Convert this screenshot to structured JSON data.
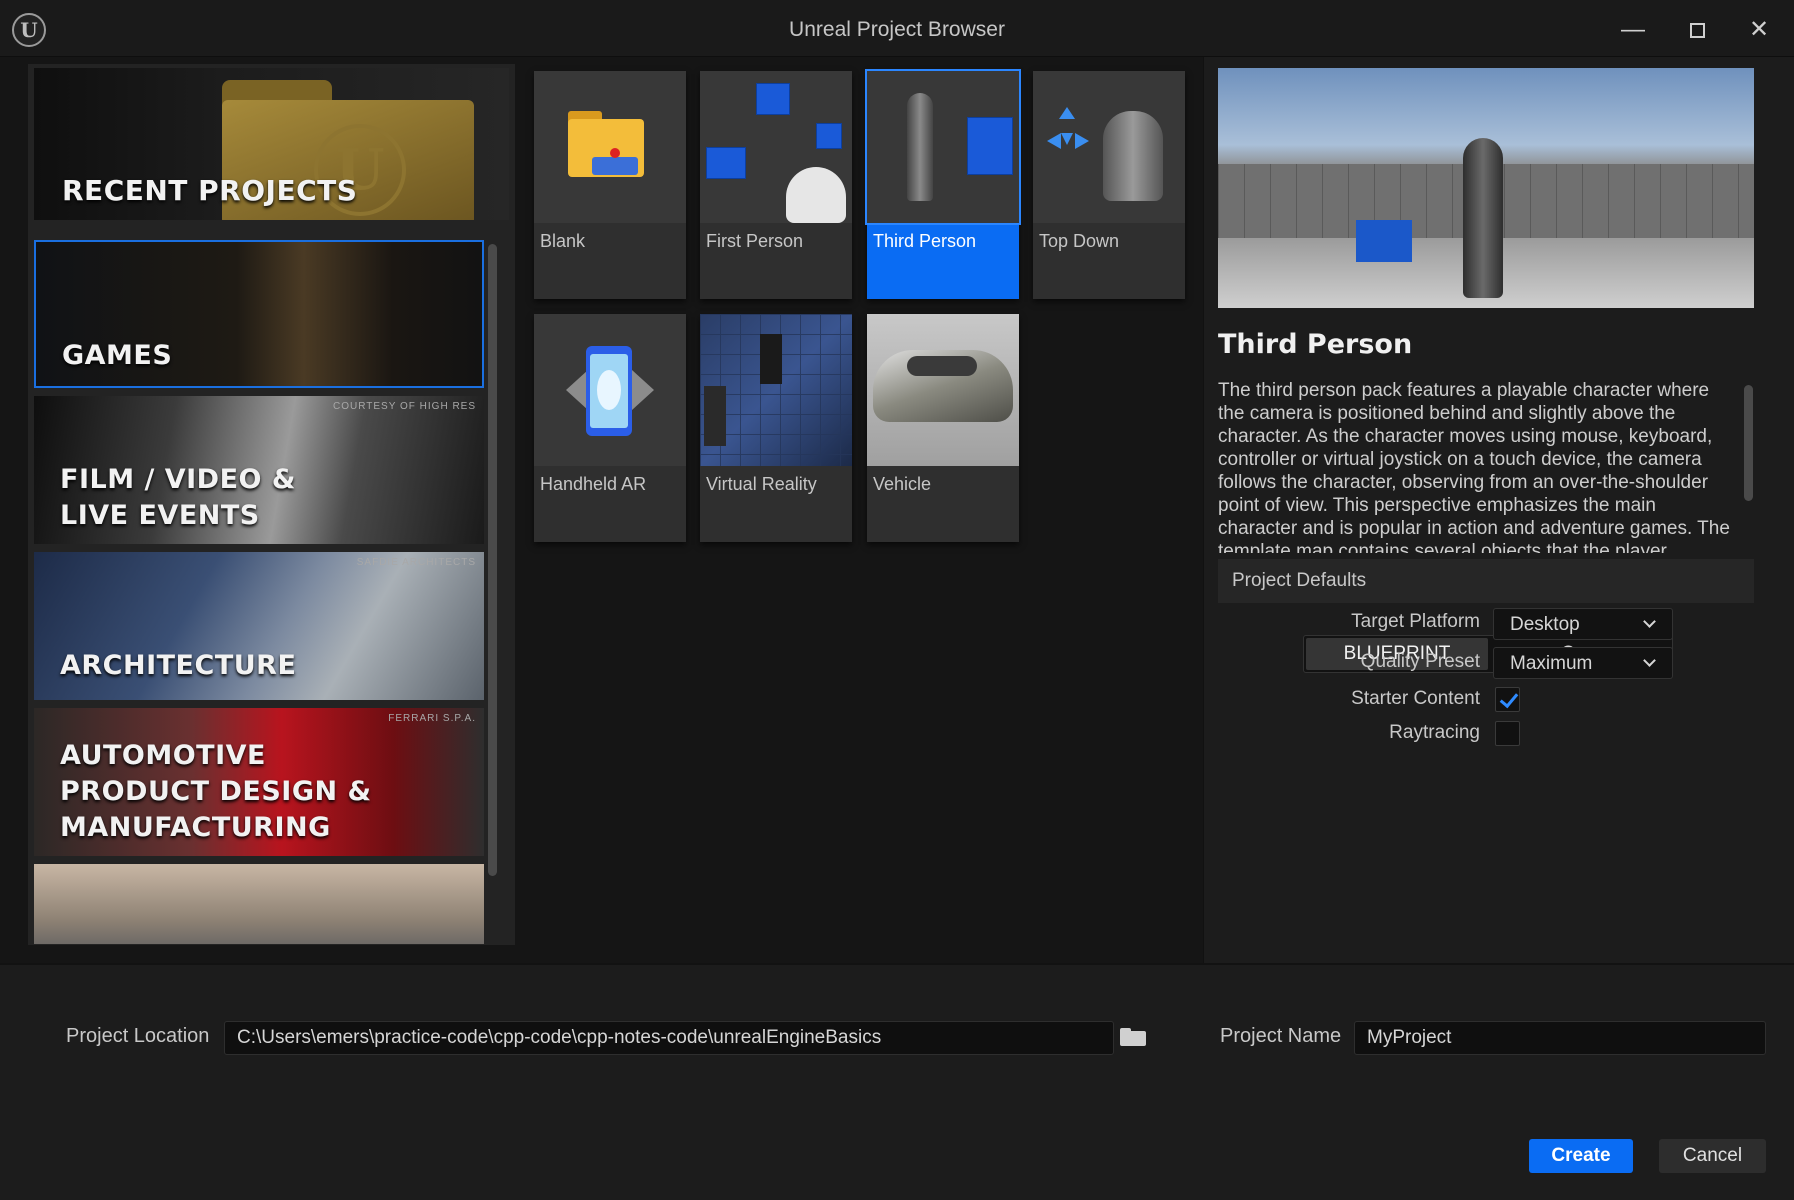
{
  "window": {
    "title": "Unreal Project Browser",
    "logo_letter": "U",
    "minimize_glyph": "—",
    "close_glyph": "✕"
  },
  "categories": {
    "recent": "RECENT PROJECTS",
    "games": "GAMES",
    "film_line1": "FILM / VIDEO &",
    "film_line2": "LIVE EVENTS",
    "film_credit": "COURTESY OF HIGH RES",
    "architecture": "ARCHITECTURE",
    "arch_credit": "SAFDIE ARCHITECTS",
    "auto_line1": "AUTOMOTIVE",
    "auto_line2": "PRODUCT DESIGN &",
    "auto_line3": "MANUFACTURING",
    "auto_credit": "FERRARI S.P.A."
  },
  "templates": [
    {
      "label": "Blank"
    },
    {
      "label": "First Person"
    },
    {
      "label": "Third Person"
    },
    {
      "label": "Top Down"
    },
    {
      "label": "Handheld AR"
    },
    {
      "label": "Virtual Reality"
    },
    {
      "label": "Vehicle"
    }
  ],
  "selected_template": "Third Person",
  "details": {
    "title": "Third Person",
    "description": "The third person pack features a playable character where the camera is positioned behind and slightly above the character. As the character moves using mouse, keyboard, controller or virtual joystick on a touch device, the camera follows the character, observing from an over-the-shoulder point of view. This perspective emphasizes the main character and is popular in action and adventure games. The template map contains several objects that the player",
    "defaults_header": "Project Defaults"
  },
  "project_defaults": {
    "blueprint": "BLUEPRINT",
    "cpp": "C++",
    "target_platform_label": "Target Platform",
    "target_platform_value": "Desktop",
    "quality_preset_label": "Quality Preset",
    "quality_preset_value": "Maximum",
    "starter_content_label": "Starter Content",
    "starter_content_checked": true,
    "raytracing_label": "Raytracing",
    "raytracing_checked": false
  },
  "bottom": {
    "location_label": "Project Location",
    "location_value": "C:\\Users\\emers\\practice-code\\cpp-code\\cpp-notes-code\\unrealEngineBasics",
    "name_label": "Project Name",
    "name_value": "MyProject",
    "create": "Create",
    "cancel": "Cancel"
  },
  "colors": {
    "accent": "#0a6cf3",
    "background": "#151515",
    "panel": "#232323"
  }
}
